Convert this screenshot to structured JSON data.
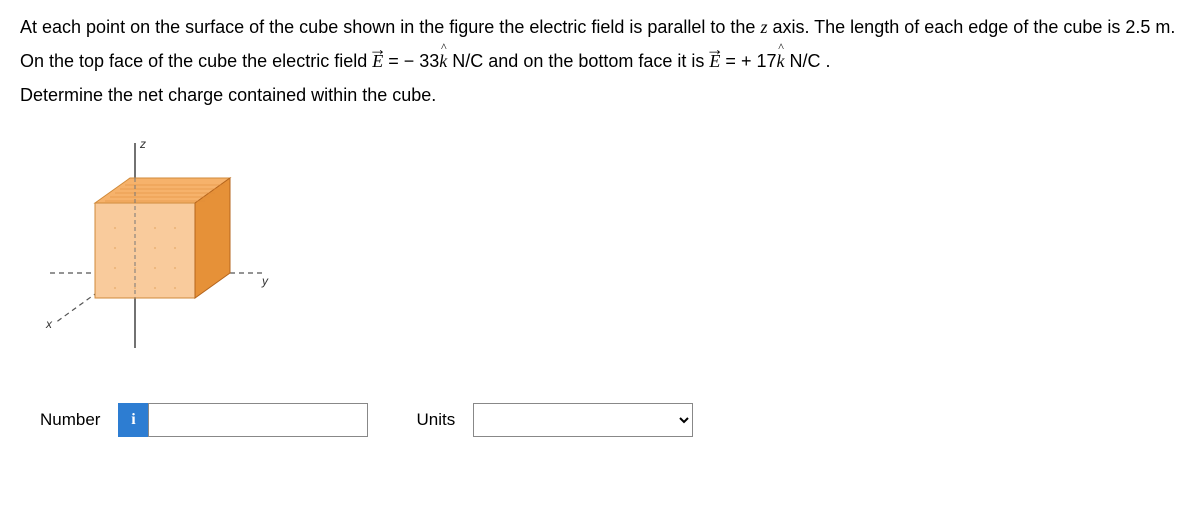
{
  "problem": {
    "part1": "At each point on the surface of the cube shown in the figure the electric field is parallel to the ",
    "axis": "z",
    "part2": " axis. The length of each edge of the cube is ",
    "edge_length": "2.5 m",
    "part3": ". On the top face of the cube the electric field ",
    "field_symbol": "E",
    "eq": " = ",
    "top_value": " − 33",
    "unit_vector": "k",
    "nc1": "   N/C  and on the bottom face it is ",
    "bottom_value": " + 17",
    "nc2": "   N/C .",
    "part4": "Determine the net charge contained within the cube."
  },
  "figure": {
    "axis_x": "x",
    "axis_y": "y",
    "axis_z": "z"
  },
  "answer": {
    "number_label": "Number",
    "info_icon": "i",
    "number_value": "",
    "units_label": "Units",
    "units_value": ""
  }
}
